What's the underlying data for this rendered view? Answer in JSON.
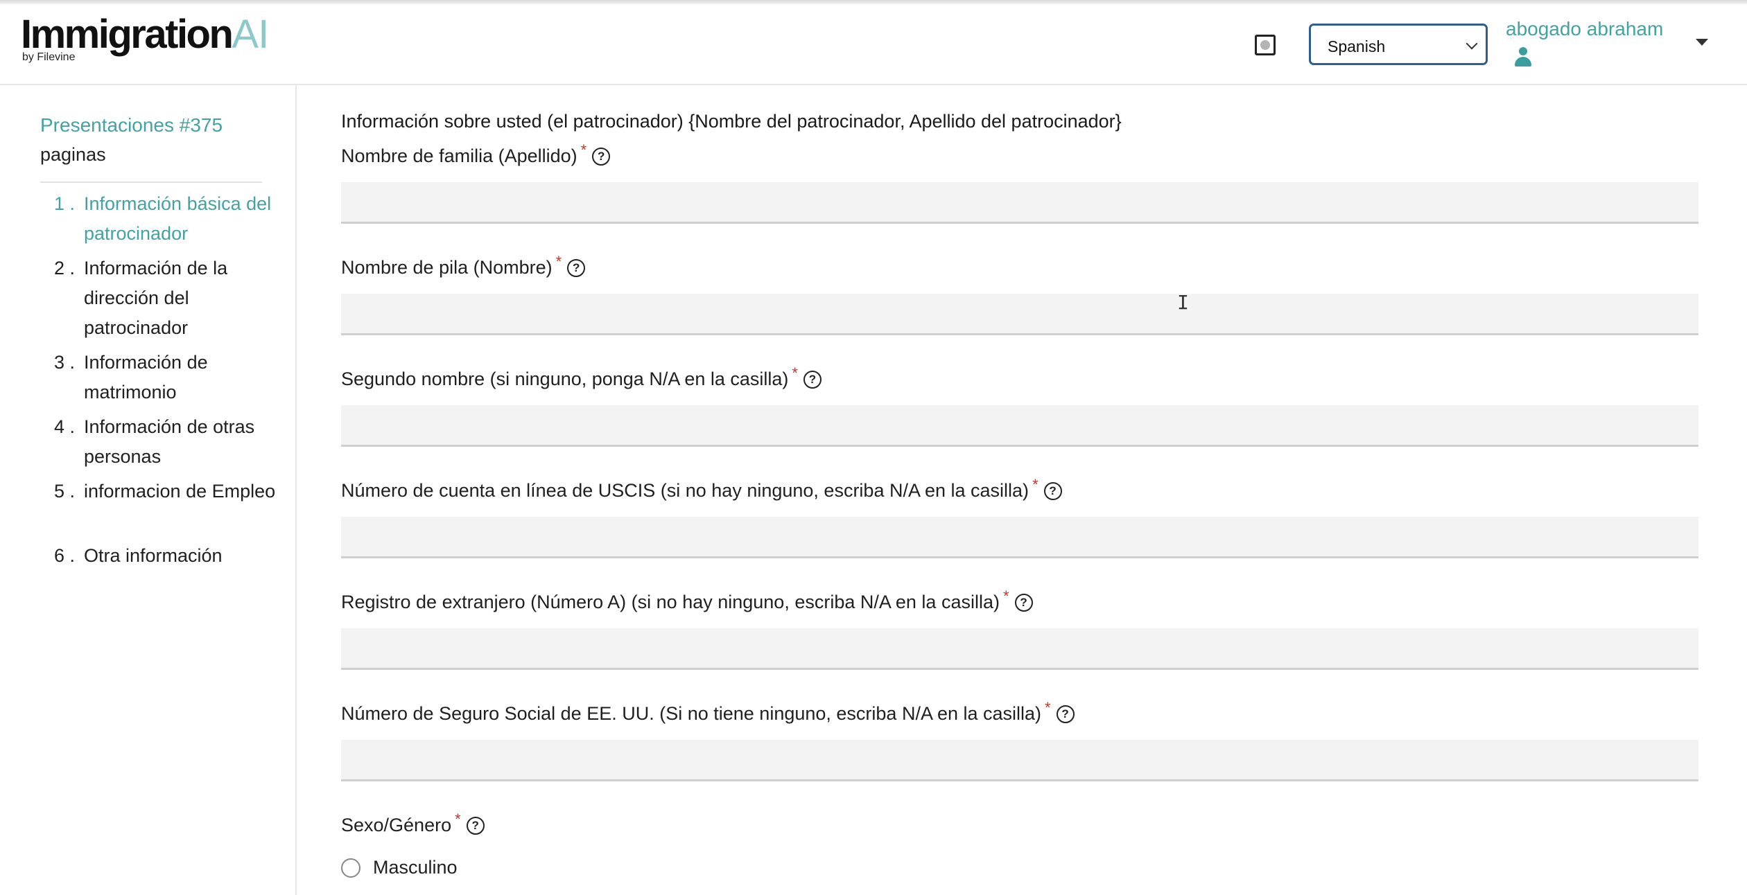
{
  "header": {
    "logo_main": "Immigration",
    "logo_ai": "AI",
    "logo_sub": "by Filevine",
    "language": {
      "selected": "Spanish"
    },
    "user": {
      "name": "abogado abraham"
    }
  },
  "sidebar": {
    "title": "Presentaciones #375",
    "subtitle": "paginas",
    "items": [
      {
        "num": "1 .",
        "label": "Información básica del patrocinador",
        "active": true
      },
      {
        "num": "2 .",
        "label": "Información de la dirección del patrocinador"
      },
      {
        "num": "3 .",
        "label": "Información de matrimonio"
      },
      {
        "num": "4 .",
        "label": "Información de otras personas"
      },
      {
        "num": "5 .",
        "label": "informacion de Empleo"
      },
      {
        "num": "6 .",
        "label": "Otra información"
      }
    ]
  },
  "main": {
    "section_title": "Información sobre usted (el patrocinador) {Nombre del patrocinador, Apellido del patrocinador}",
    "required_mark": "*",
    "help_glyph": "?",
    "fields": [
      {
        "label": "Nombre de familia (Apellido)",
        "value": ""
      },
      {
        "label": "Nombre de pila (Nombre)",
        "value": ""
      },
      {
        "label": "Segundo nombre (si ninguno, ponga N/A en la casilla)",
        "value": ""
      },
      {
        "label": "Número de cuenta en línea de USCIS (si no hay ninguno, escriba N/A en la casilla)",
        "value": ""
      },
      {
        "label": "Registro de extranjero (Número A) (si no hay ninguno, escriba N/A en la casilla)",
        "value": ""
      },
      {
        "label": "Número de Seguro Social de EE. UU. (Si no tiene ninguno, escriba N/A en la casilla)",
        "value": ""
      }
    ],
    "gender": {
      "label": "Sexo/Género",
      "options": [
        "Masculino"
      ]
    }
  }
}
